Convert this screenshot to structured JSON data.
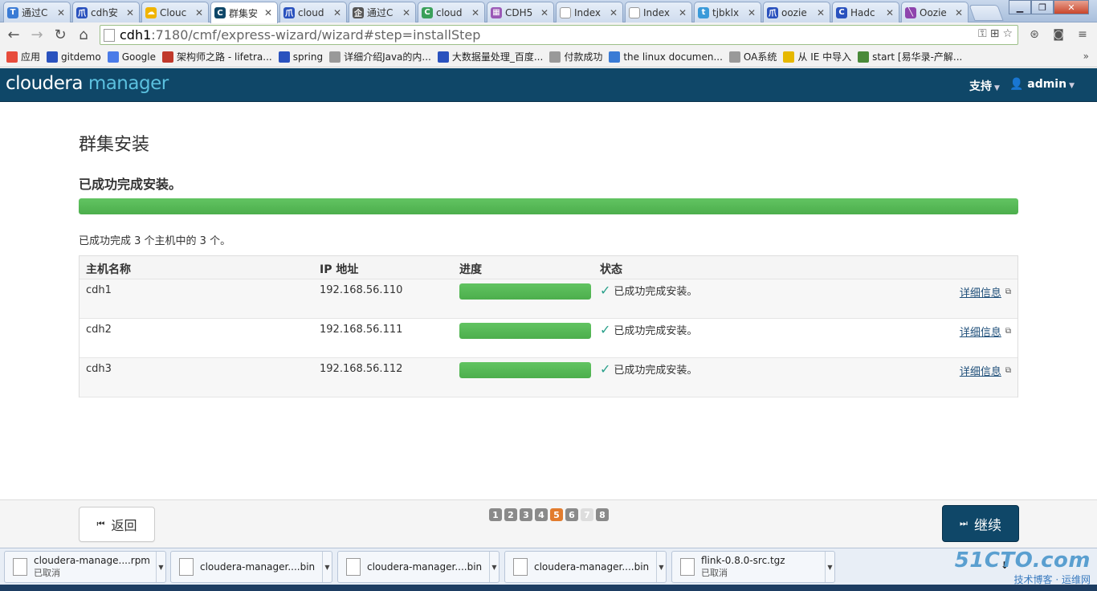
{
  "browser": {
    "tabs": [
      {
        "label": "通过C",
        "fav": "T",
        "color": "#3a7bd5"
      },
      {
        "label": "cdh安",
        "fav": "爪",
        "color": "#2a52be"
      },
      {
        "label": "Clouc",
        "fav": "☁",
        "color": "#f0b400"
      },
      {
        "label": "群集安",
        "fav": "C",
        "color": "#0f4768"
      },
      {
        "label": "cloud",
        "fav": "爪",
        "color": "#2a52be"
      },
      {
        "label": "通过C",
        "fav": "企",
        "color": "#555555"
      },
      {
        "label": "cloud",
        "fav": "C",
        "color": "#3aa05a"
      },
      {
        "label": "CDH5",
        "fav": "▦",
        "color": "#9b59b6"
      },
      {
        "label": "Index",
        "fav": "",
        "color": "#ffffff"
      },
      {
        "label": "Index",
        "fav": "",
        "color": "#ffffff"
      },
      {
        "label": "tjbklx",
        "fav": "t",
        "color": "#3a9ad9"
      },
      {
        "label": "oozie",
        "fav": "爪",
        "color": "#2a52be"
      },
      {
        "label": "Hadc",
        "fav": "C",
        "color": "#2a52be"
      },
      {
        "label": "Oozie",
        "fav": "╲",
        "color": "#8e44ad"
      }
    ],
    "url_host": "cdh1",
    "url_path": ":7180/cmf/express-wizard/wizard#step=installStep",
    "bookmarks": [
      {
        "label": "应用",
        "color": "#e74c3c"
      },
      {
        "label": "gitdemo",
        "color": "#2a52be"
      },
      {
        "label": "Google",
        "color": "#4a7be8"
      },
      {
        "label": "架构师之路 - lifetra...",
        "color": "#c0392b"
      },
      {
        "label": "spring",
        "color": "#2a52be"
      },
      {
        "label": "详细介绍Java的内...",
        "color": "#999999"
      },
      {
        "label": "大数据量处理_百度...",
        "color": "#2a52be"
      },
      {
        "label": "付款成功",
        "color": "#999999"
      },
      {
        "label": "the linux documen...",
        "color": "#3a7bd5"
      },
      {
        "label": "OA系统",
        "color": "#999999"
      },
      {
        "label": "从 IE 中导入",
        "color": "#e6b800"
      },
      {
        "label": "start [易华录-产解...",
        "color": "#4a8a3a"
      }
    ]
  },
  "header": {
    "logo_a": "cloudera",
    "logo_b": "manager",
    "support": "支持",
    "user": "admin"
  },
  "main": {
    "title": "群集安装",
    "status": "已成功完成安装。",
    "overall_progress": 100,
    "summary": "已成功完成 3 个主机中的 3 个。",
    "columns": [
      "主机名称",
      "IP 地址",
      "进度",
      "状态"
    ],
    "rows": [
      {
        "host": "cdh1",
        "ip": "192.168.56.110",
        "progress": 100,
        "status": "已成功完成安装。",
        "detail": "详细信息"
      },
      {
        "host": "cdh2",
        "ip": "192.168.56.111",
        "progress": 100,
        "status": "已成功完成安装。",
        "detail": "详细信息"
      },
      {
        "host": "cdh3",
        "ip": "192.168.56.112",
        "progress": 100,
        "status": "已成功完成安装。",
        "detail": "详细信息"
      }
    ]
  },
  "footer": {
    "back": "返回",
    "continue": "继续",
    "steps": [
      "1",
      "2",
      "3",
      "4",
      "5",
      "6",
      "7",
      "8"
    ],
    "current_step": 5
  },
  "downloads": [
    {
      "name": "cloudera-manage....rpm",
      "status": "已取消"
    },
    {
      "name": "cloudera-manager....bin",
      "status": ""
    },
    {
      "name": "cloudera-manager....bin",
      "status": ""
    },
    {
      "name": "cloudera-manager....bin",
      "status": ""
    },
    {
      "name": "flink-0.8.0-src.tgz",
      "status": "已取消"
    }
  ],
  "watermark": {
    "line1": "51CTO.com",
    "line2": "技术博客 · 运维网"
  }
}
